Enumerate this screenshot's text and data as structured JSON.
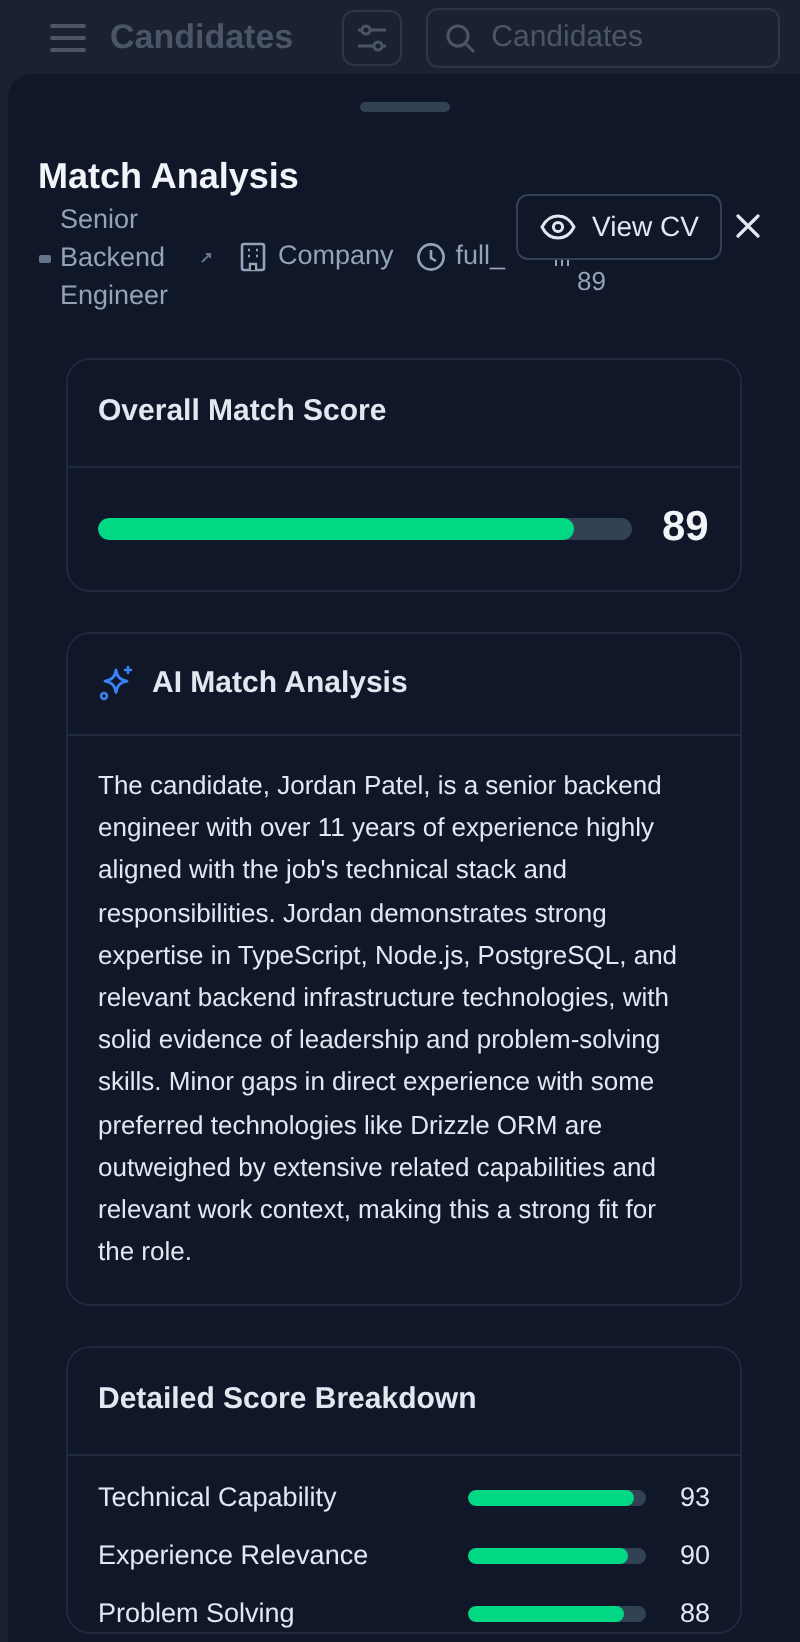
{
  "background_header": {
    "title": "Candidates",
    "search": {
      "placeholder": "Candidates"
    }
  },
  "sheet": {
    "title": "Match Analysis",
    "meta": {
      "job_title": "Senior Backend Engineer",
      "company": "Company",
      "employment_type": "full_",
      "score": "89"
    },
    "view_cv_button": "View CV"
  },
  "overall": {
    "title": "Overall Match Score",
    "level": 0.89,
    "score": "89"
  },
  "ai_analysis": {
    "title": "AI Match Analysis",
    "text": "The candidate, Jordan Patel, is a senior backend engineer with over 11 years of experience highly aligned with the job's technical stack and responsibilities. Jordan demonstrates strong expertise in TypeScript, Node.js, PostgreSQL, and relevant backend infrastructure technologies, with solid evidence of leadership and problem-solving skills. Minor gaps in direct experience with some preferred technologies like Drizzle ORM are outweighed by extensive related capabilities and relevant work context, making this a strong fit for the role."
  },
  "breakdown": {
    "title": "Detailed Score Breakdown",
    "items": [
      {
        "label": "Technical Capability",
        "level": 0.93,
        "score": "93"
      },
      {
        "label": "Experience Relevance",
        "level": 0.9,
        "score": "90"
      },
      {
        "label": "Problem Solving",
        "level": 0.88,
        "score": "88"
      }
    ]
  }
}
